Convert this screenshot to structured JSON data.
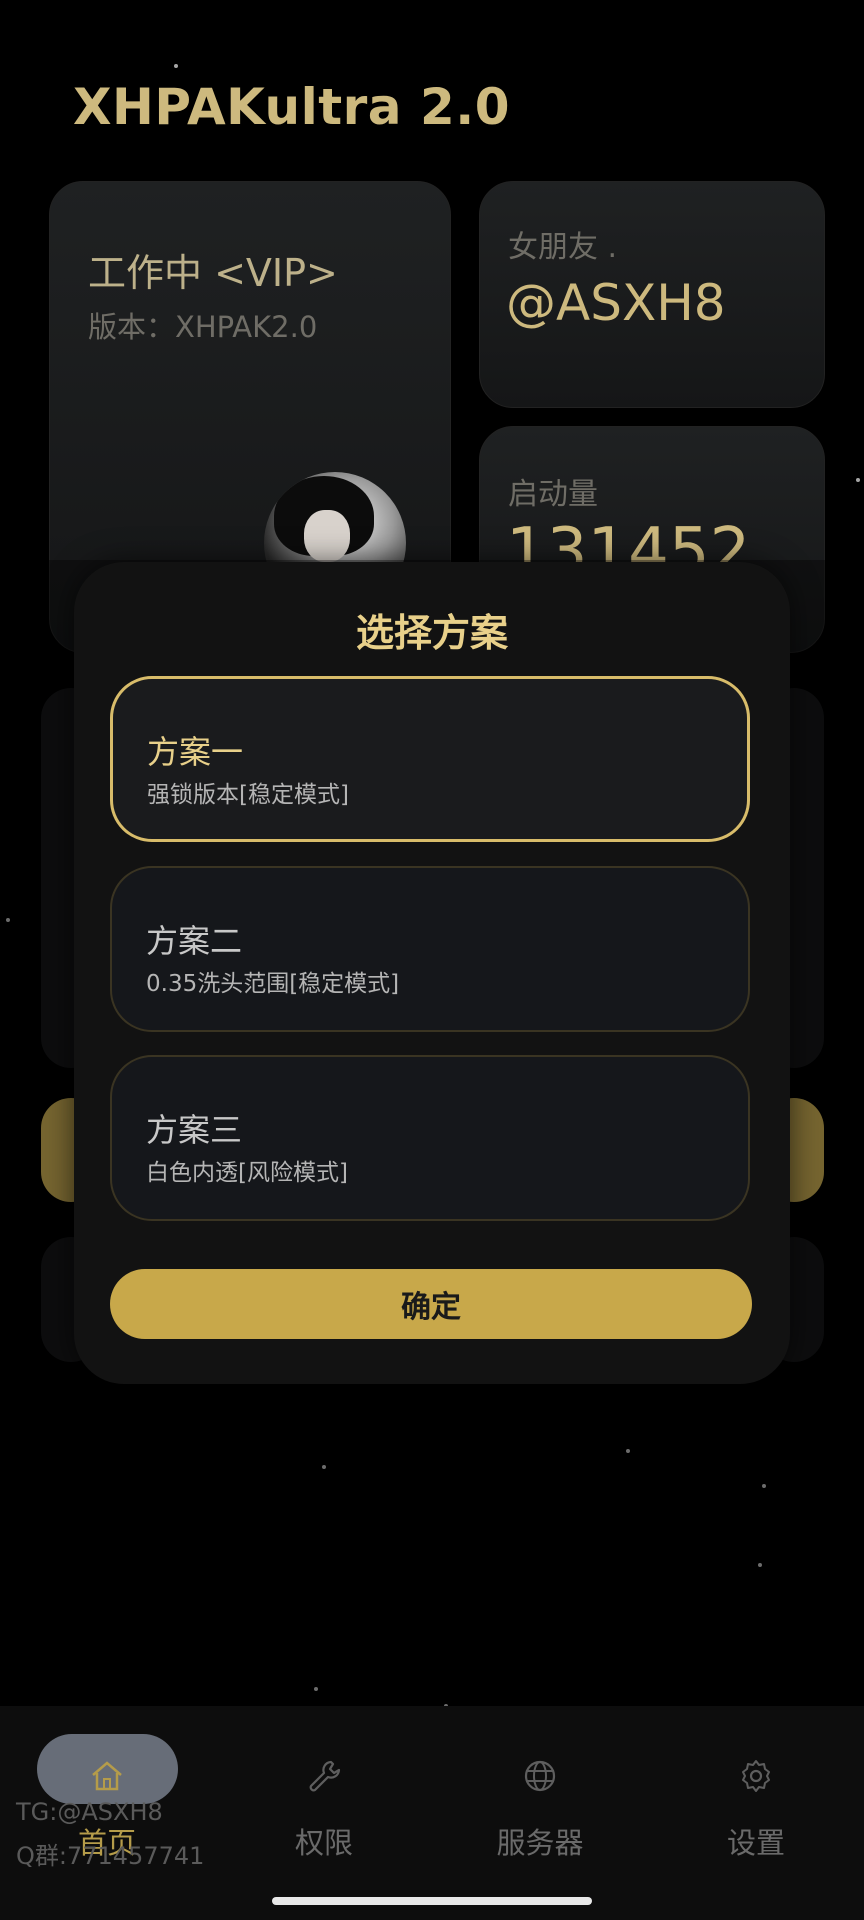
{
  "app": {
    "title": "XHPAKultra 2.0"
  },
  "status_card": {
    "status": "工作中 <VIP>",
    "version": "版本：XHPAK2.0"
  },
  "girlfriend_card": {
    "label": "女朋友 .",
    "value": "@ASXH8"
  },
  "launch_card": {
    "label": "启动量",
    "value": "131452"
  },
  "dialog": {
    "title": "选择方案",
    "options": [
      {
        "name": "方案一",
        "desc": "强锁版本[稳定模式]",
        "selected": true
      },
      {
        "name": "方案二",
        "desc": "0.35洗头范围[稳定模式]",
        "selected": false
      },
      {
        "name": "方案三",
        "desc": "白色内透[风险模式]",
        "selected": false
      }
    ],
    "confirm_label": "确定"
  },
  "nav": {
    "items": [
      {
        "label": "首页",
        "icon": "home-icon",
        "active": true
      },
      {
        "label": "权限",
        "icon": "wrench-icon",
        "active": false
      },
      {
        "label": "服务器",
        "icon": "globe-icon",
        "active": false
      },
      {
        "label": "设置",
        "icon": "gear-icon",
        "active": false
      }
    ]
  },
  "watermark": {
    "line1": "TG:@ASXH8",
    "line2": "Q群:771457741"
  },
  "colors": {
    "gold": "#c8a84a",
    "gold_text": "#cdb97e",
    "background": "#000000"
  }
}
